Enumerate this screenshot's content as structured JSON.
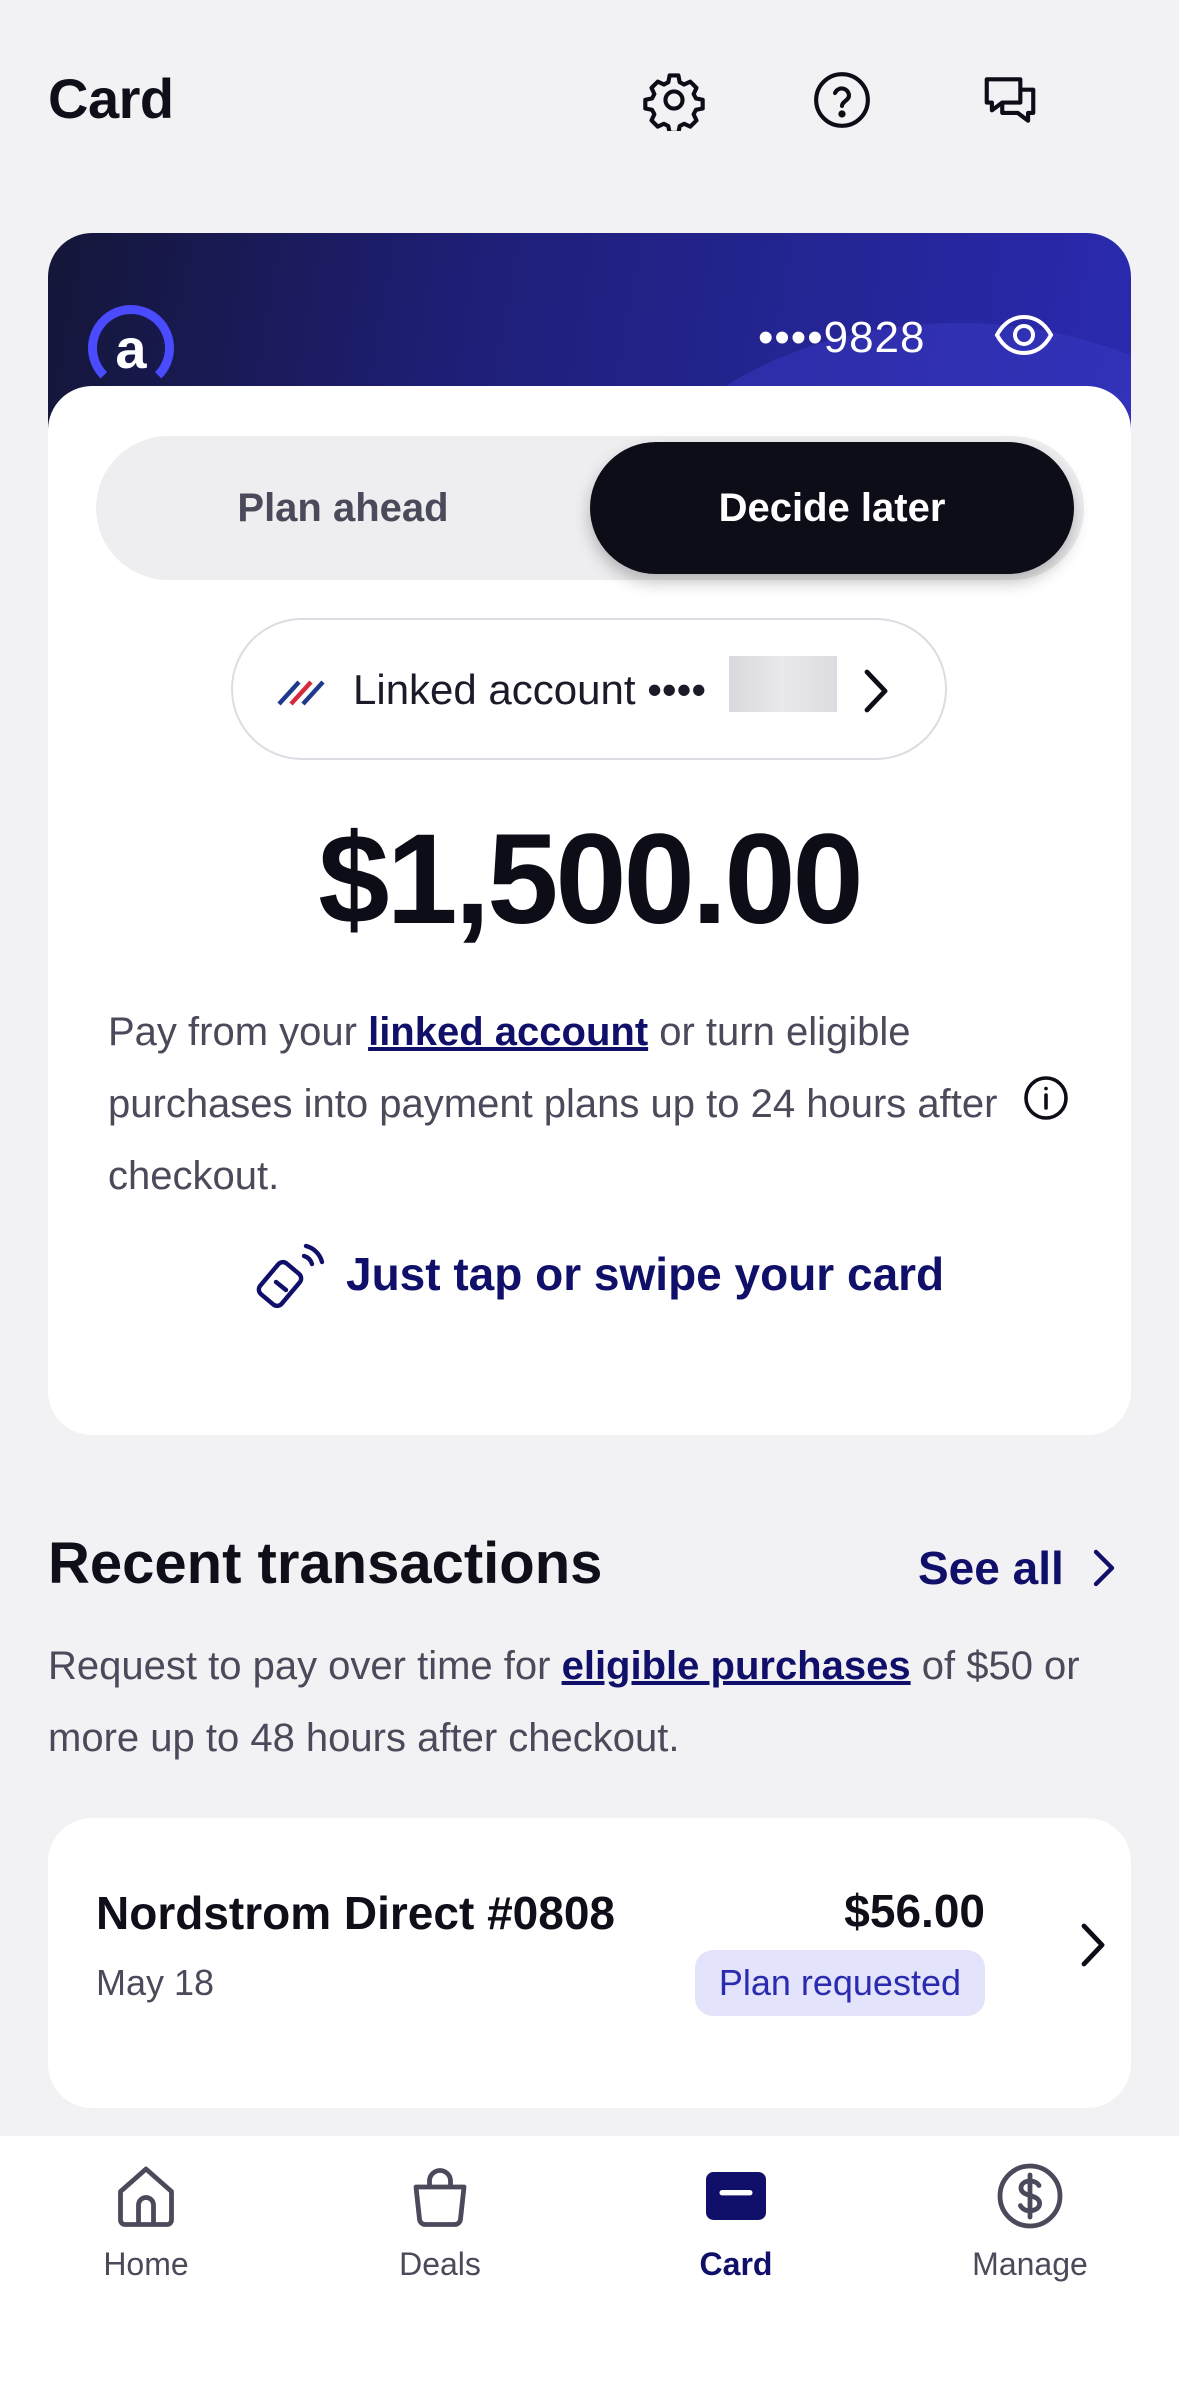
{
  "header": {
    "title": "Card",
    "icons": [
      "gear-icon",
      "help-icon",
      "chat-icon"
    ]
  },
  "card": {
    "logo_letter": "a",
    "number_masked": "••••9828",
    "mode_toggle": {
      "options": [
        "Plan ahead",
        "Decide later"
      ],
      "selected": "Decide later"
    },
    "linked_account_label": "Linked account ••••",
    "amount": "$1,500.00",
    "description": {
      "prefix": "Pay from your ",
      "link": "linked account",
      "suffix": " or turn eligible purchases into payment plans up to 24 hours after checkout."
    },
    "tap_text": "Just tap or swipe your card"
  },
  "transactions": {
    "title": "Recent transactions",
    "see_all": "See all",
    "description": {
      "prefix": "Request to pay over time for ",
      "link": "eligible purchases",
      "suffix": " of $50 or more up to 48 hours after checkout."
    },
    "items": [
      {
        "merchant": "Nordstrom Direct #0808",
        "date": "May 18",
        "amount": "$56.00",
        "status": "Plan requested"
      }
    ]
  },
  "nav": {
    "items": [
      {
        "label": "Home",
        "icon": "home-icon"
      },
      {
        "label": "Deals",
        "icon": "bag-icon"
      },
      {
        "label": "Card",
        "icon": "card-icon",
        "active": true
      },
      {
        "label": "Manage",
        "icon": "dollar-icon"
      }
    ]
  },
  "colors": {
    "accent": "#10106a",
    "dark": "#0d0d18",
    "badge_bg": "#e3e3fc",
    "background": "#f2f2f4"
  }
}
